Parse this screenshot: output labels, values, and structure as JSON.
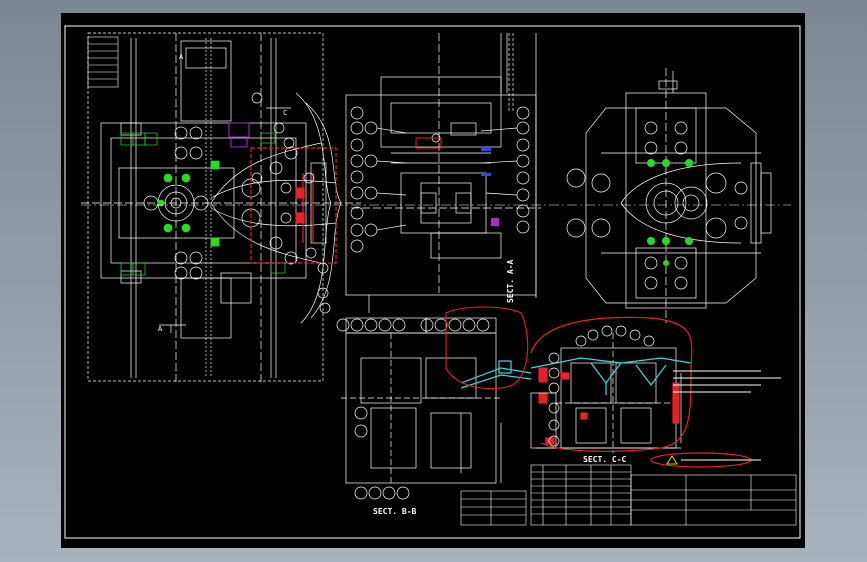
{
  "viewport": {
    "background_top": "#7d8794",
    "background_bottom": "#a9b2bd",
    "sheet_color": "#000000"
  },
  "colors": {
    "line": "#ffffff",
    "green": "#22dd22",
    "red": "#e8202a",
    "cyan": "#33dddd",
    "purple": "#9933cc",
    "blue": "#3344ff",
    "yellow": "#ffff33"
  },
  "drawing": {
    "section_bb_label": "SECT. B-B",
    "section_cc_label": "SECT. C-C",
    "section_aa_label": "SECT. A-A",
    "view_marker_a": "A",
    "view_marker_c": "C"
  },
  "icons": {
    "balloon": "balloon-callout-icon",
    "bolt": "bolt-head-icon",
    "warning": "warning-triangle-icon"
  }
}
